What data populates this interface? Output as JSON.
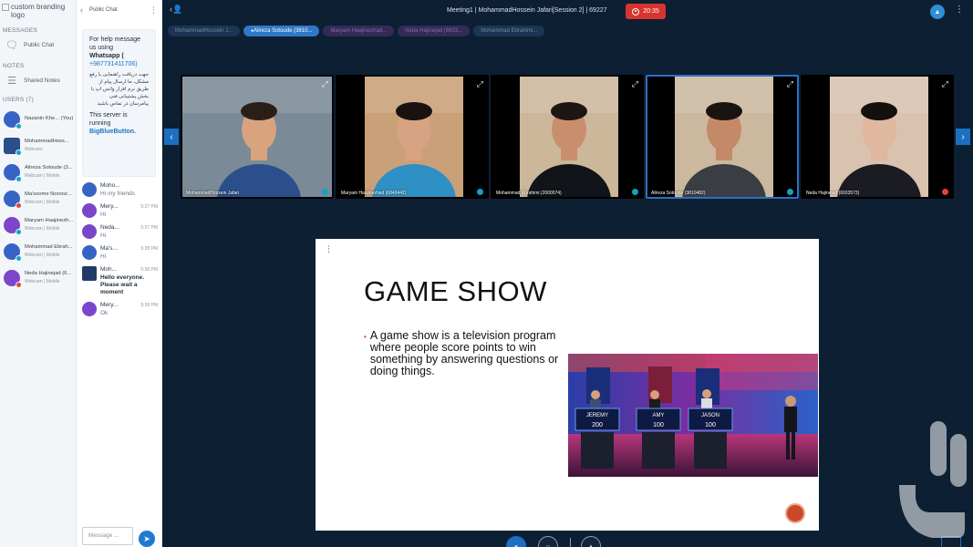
{
  "branding": {
    "alt": "custom branding logo"
  },
  "user_panel": {
    "messages_header": "MESSAGES",
    "public_chat": "Public Chat",
    "notes_header": "NOTES",
    "shared_notes": "Shared Notes",
    "users_header": "USERS (7)",
    "users": [
      {
        "name": "Nazanin Khe... (You)",
        "status": "",
        "style": "blue"
      },
      {
        "name": "MohammadHoss...",
        "status": "Webcam",
        "style": "pic"
      },
      {
        "name": "Alireza Sotoude (3...",
        "status": "Webcam | Mobile",
        "style": "blue"
      },
      {
        "name": "Ma'soome Norooz...",
        "status": "Webcam | Mobile",
        "style": "blue"
      },
      {
        "name": "Maryam Haajinezh...",
        "status": "Webcam | Mobile",
        "style": "purple"
      },
      {
        "name": "Mohammad Ebrah...",
        "status": "Webcam | Mobile",
        "style": "blue"
      },
      {
        "name": "Neda Hajinejad (6...",
        "status": "Webcam | Mobile",
        "style": "purple"
      }
    ]
  },
  "chat": {
    "title": "Public Chat",
    "welcome": {
      "line1": "For help message us using",
      "whatsapp": "Whatsapp (",
      "phone": "+987731411706)",
      "rtl": "جهت دریافت راهنمایی یا رفع مشکل، ما ارسال پیام از طریق نرم افزار واتس اپ با بخش پشتیبانی فنی پیامرسان در تماس باشید",
      "server_line": "This server is running",
      "bbb": "BigBlueButton."
    },
    "messages": [
      {
        "sender": "Moho...",
        "time": "",
        "text": "Hi my friends",
        "style": "blue",
        "bold": false
      },
      {
        "sender": "Mery...",
        "time": "5:37 PM",
        "text": "Hi",
        "style": "purple",
        "bold": false
      },
      {
        "sender": "Neda...",
        "time": "5:37 PM",
        "text": "Hi",
        "style": "purple",
        "bold": false
      },
      {
        "sender": "Ma's...",
        "time": "5:38 PM",
        "text": "Hi",
        "style": "blue",
        "bold": false
      },
      {
        "sender": "Moh...",
        "time": "5:38 PM",
        "text": "Hello everyone. Please wait a moment",
        "style": "pic",
        "bold": true
      },
      {
        "sender": "Mery...",
        "time": "5:38 PM",
        "text": "Ok",
        "style": "purple",
        "bold": false
      }
    ],
    "input_placeholder": "Message ..."
  },
  "top_bar": {
    "meeting_title": "Meeting1 | MohammadHossein Jafari[Session 2] | 69227",
    "record_time": "20:35"
  },
  "talkers": [
    {
      "name": "MohammadHossein J...",
      "state": "idle"
    },
    {
      "name": "Alireza Sotoude (3810...",
      "state": "active"
    },
    {
      "name": "Maryam Haajinezhad...",
      "state": "purple"
    },
    {
      "name": "Neda Hajinejad (6933...",
      "state": "purple"
    },
    {
      "name": "Mohammad Ebrahimi...",
      "state": "idle"
    }
  ],
  "videos": [
    {
      "label": "MohammadHossein Jafari",
      "audio": "blue",
      "bg": "#7a8a96",
      "skin": "#d9a37e",
      "shirt": "#2a4f8a",
      "hair": "#2b1e16",
      "selected": false
    },
    {
      "label": "Maryam Haajinezhad (6840442)",
      "audio": "blue",
      "bg": "#c9a078",
      "skin": "#d7a383",
      "shirt": "#2e90c4",
      "hair": "#1a1210",
      "selected": false
    },
    {
      "label": "Mohammad Ebrahimi (2000074)",
      "audio": "blue",
      "bg": "#cdb79b",
      "skin": "#c98f6d",
      "shirt": "#111418",
      "hair": "#1d1612",
      "selected": false
    },
    {
      "label": "Alireza Sotoude (3810482)",
      "audio": "blue",
      "bg": "#cbb89f",
      "skin": "#c48a68",
      "shirt": "#3a3e44",
      "hair": "#1a1411",
      "selected": true
    },
    {
      "label": "Neda Hajinejad (6933573)",
      "audio": "red",
      "bg": "#d9c2ae",
      "skin": "#e0b79f",
      "shirt": "#1b1b22",
      "hair": "#14100e",
      "selected": false
    }
  ],
  "slide": {
    "title": "GAME SHOW",
    "bullet": "A game show is a television program where people score points to win something by answering questions or doing things.",
    "contestants": [
      {
        "name": "JEREMY",
        "score": "200"
      },
      {
        "name": "AMY",
        "score": "100"
      },
      {
        "name": "JASON",
        "score": "100"
      }
    ]
  },
  "colors": {
    "primary": "#1e6fc3",
    "record": "#d7342e",
    "accent_purple": "#7b46c9"
  }
}
